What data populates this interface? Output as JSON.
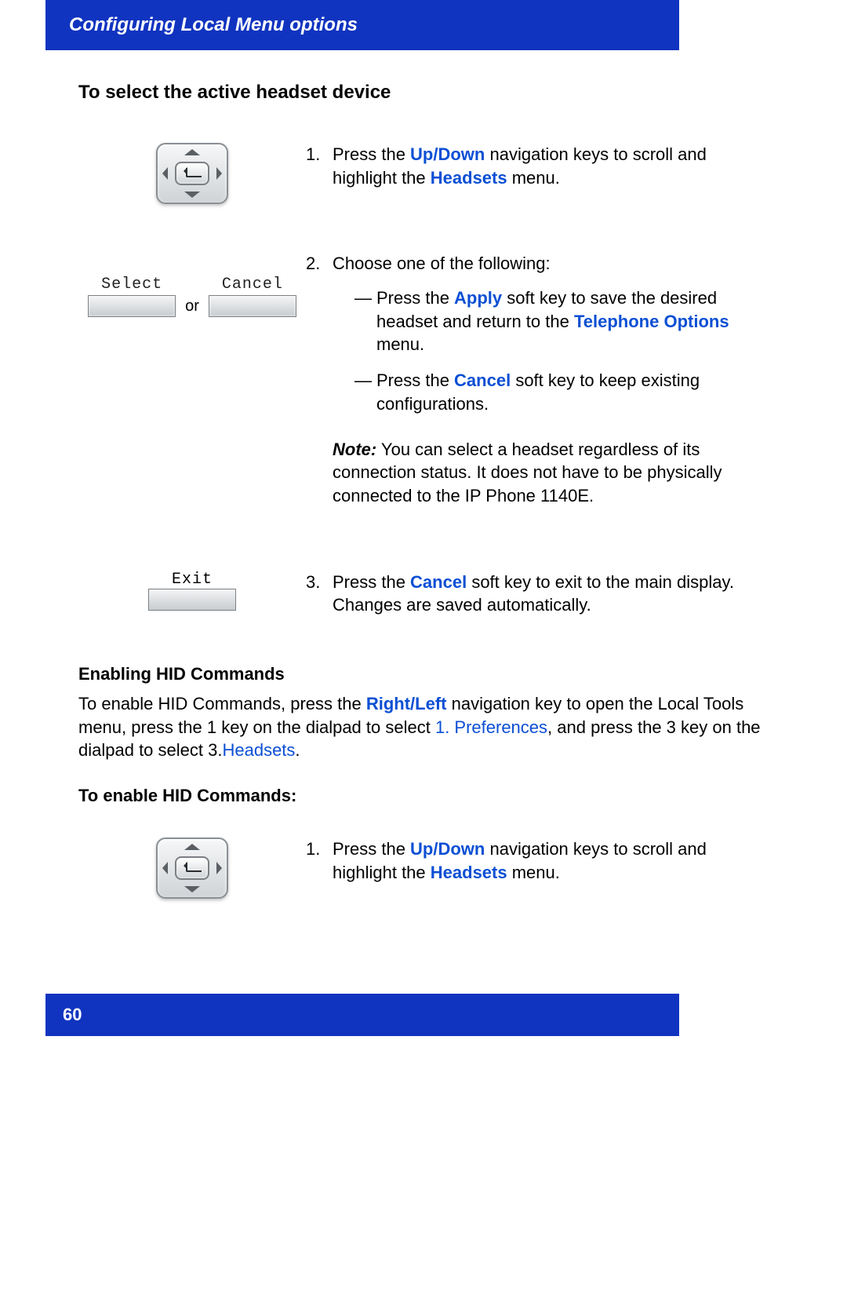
{
  "header": {
    "title": "Configuring Local Menu options"
  },
  "section1": {
    "title": "To select the active headset device",
    "step1": {
      "num": "1.",
      "prefix": "Press the ",
      "link1": "Up/Down",
      "mid": " navigation keys to scroll and highlight the ",
      "link2": "Headsets",
      "suffix": " menu."
    },
    "step2": {
      "num": "2.",
      "intro": "Choose one of the following:",
      "soft_select": "Select",
      "soft_cancel": "Cancel",
      "or": "or",
      "bullet1": {
        "prefix": "Press the ",
        "link1": "Apply",
        "mid": " soft key to save the desired headset and return to the ",
        "link2": "Telephone Options",
        "suffix": " menu."
      },
      "bullet2": {
        "prefix": "Press the ",
        "link1": "Cancel",
        "suffix": " soft key to keep existing configurations."
      },
      "note_label": "Note:",
      "note_body": " You can select a headset regardless of its connection status. It does not have to be physically connected to the IP Phone 1140E."
    },
    "step3": {
      "num": "3.",
      "soft_exit": "Exit",
      "prefix": "Press the ",
      "link1": "Cancel",
      "suffix": " soft key to exit to the main display. Changes are saved automatically."
    }
  },
  "section2": {
    "title": "Enabling HID Commands",
    "para": {
      "p1": "To enable HID Commands, press the ",
      "link1": "Right/Left",
      "p2": " navigation key to open the Local Tools menu, press the 1 key on the dialpad to select ",
      "link2": "1. Preferences",
      "p3": ", and press the 3 key on the dialpad to select 3.",
      "link3": "Headsets",
      "p4": "."
    },
    "subtitle": "To enable HID Commands:",
    "step1": {
      "num": "1.",
      "prefix": "Press the ",
      "link1": "Up/Down",
      "mid": " navigation keys to scroll and highlight the ",
      "link2": "Headsets",
      "suffix": " menu."
    }
  },
  "footer": {
    "page": "60"
  }
}
